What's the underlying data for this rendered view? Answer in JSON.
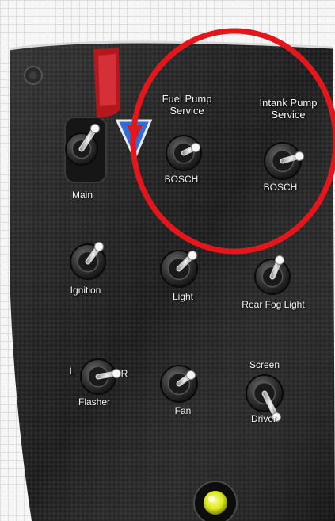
{
  "labels": {
    "fuel_pump_service": "Fuel Pump\nService",
    "intank_pump_service": "Intank Pump\nService",
    "bosch_1": "BOSCH",
    "bosch_2": "BOSCH",
    "main": "Main",
    "ignition": "Ignition",
    "light": "Light",
    "rear_fog_light": "Rear Fog Light",
    "flasher": "Flasher",
    "flasher_left": "L",
    "flasher_right": "R",
    "fan": "Fan",
    "screen": "Screen",
    "driver": "Driver"
  },
  "colors": {
    "panel": "#1b1b1b",
    "highlight_circle": "#e3161c",
    "safety_cover": "#c8202a",
    "warning_triangle": "#2f6ed8",
    "indicator_light": "#e6ef2a"
  },
  "icons": {
    "switch": "toggle-switch-icon",
    "cover": "safety-cover-icon",
    "triangle": "warning-triangle-icon",
    "light": "indicator-light-icon"
  }
}
